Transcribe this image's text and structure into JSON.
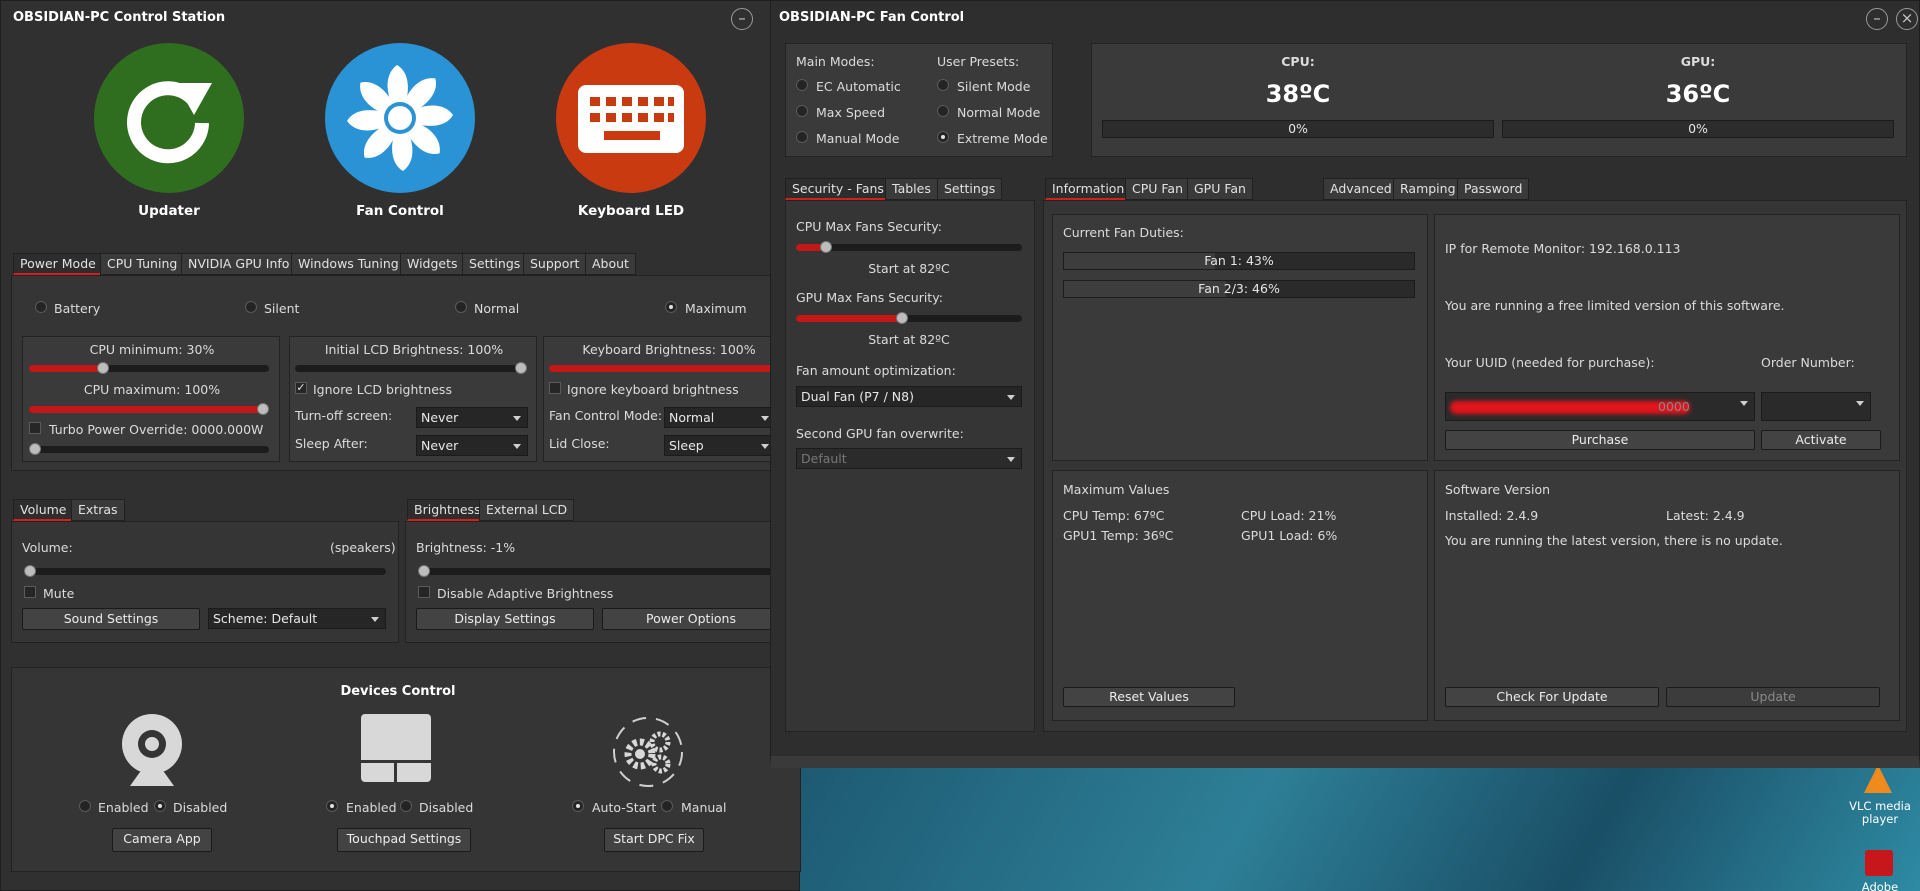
{
  "colors": {
    "accent_red": "#c41818",
    "updater": "#2f6e1f",
    "fan": "#2a93d5",
    "keyboard": "#c93a11",
    "bg": "#303030"
  },
  "control_station": {
    "title": "OBSIDIAN-PC Control Station",
    "big_buttons": [
      {
        "label": "Updater",
        "icon": "refresh-icon"
      },
      {
        "label": "Fan Control",
        "icon": "fan-icon"
      },
      {
        "label": "Keyboard LED",
        "icon": "keyboard-icon"
      }
    ],
    "tabs": [
      "Power Mode",
      "CPU Tuning",
      "NVIDIA GPU Info",
      "Windows Tuning",
      "Widgets",
      "Settings",
      "Support",
      "About"
    ],
    "power_modes": [
      "Battery",
      "Silent",
      "Normal",
      "Maximum"
    ],
    "cpu": {
      "min_label": "CPU minimum: 30%",
      "min": 30,
      "max_label": "CPU maximum: 100%",
      "max": 100,
      "turbo_label": "Turbo Power Override: 0000.000W"
    },
    "lcd": {
      "brightness_label": "Initial LCD Brightness: 100%",
      "brightness": 100,
      "ignore_label": "Ignore LCD brightness",
      "turnoff_label": "Turn-off screen:",
      "turnoff_value": "Never",
      "sleep_label": "Sleep After:",
      "sleep_value": "Never"
    },
    "keyboard": {
      "brightness_label": "Keyboard Brightness: 100%",
      "brightness": 100,
      "ignore_label": "Ignore keyboard brightness",
      "fan_mode_label": "Fan Control Mode:",
      "fan_mode_value": "Normal",
      "lid_label": "Lid Close:",
      "lid_value": "Sleep"
    },
    "volume": {
      "tabs": [
        "Volume",
        "Extras"
      ],
      "label": "Volume:",
      "device": "(speakers)",
      "value": 0,
      "mute_label": "Mute",
      "sound_btn": "Sound Settings",
      "scheme": "Scheme: Default"
    },
    "brightness": {
      "tabs": [
        "Brightness",
        "External LCD"
      ],
      "label": "Brightness: -1%",
      "value": 0,
      "adaptive_label": "Disable Adaptive Brightness",
      "display_btn": "Display Settings",
      "power_btn": "Power Options"
    },
    "devices": {
      "title": "Devices Control",
      "camera": {
        "opt1": "Enabled",
        "opt2": "Disabled",
        "button": "Camera App"
      },
      "touchpad": {
        "opt1": "Enabled",
        "opt2": "Disabled",
        "button": "Touchpad Settings"
      },
      "dpc": {
        "opt1": "Auto-Start",
        "opt2": "Manual",
        "button": "Start DPC Fix"
      }
    }
  },
  "fan_control": {
    "title": "OBSIDIAN-PC Fan Control",
    "main_modes_label": "Main Modes:",
    "main_modes": [
      "EC Automatic",
      "Max Speed",
      "Manual Mode"
    ],
    "presets_label": "User Presets:",
    "presets": [
      "Silent Mode",
      "Normal Mode",
      "Extreme Mode"
    ],
    "cpu": {
      "label": "CPU:",
      "temp": "38ºC",
      "load_text": "0%",
      "load": 0
    },
    "gpu": {
      "label": "GPU:",
      "temp": "36ºC",
      "load_text": "0%",
      "load": 0
    },
    "left_tabs": [
      "Security - Fans",
      "Tables",
      "Settings"
    ],
    "security": {
      "cpu_label": "CPU Max Fans Security:",
      "cpu_start": "Start at 82ºC",
      "cpu_value": 82,
      "gpu_label": "GPU Max Fans Security:",
      "gpu_start": "Start at 82ºC",
      "gpu_value": 82,
      "opt_label": "Fan amount optimization:",
      "opt_value": "Dual Fan (P7 / N8)",
      "gpu_over_label": "Second GPU fan overwrite:",
      "gpu_over_value": "Default"
    },
    "right_tabs": [
      "Information",
      "CPU Fan",
      "GPU Fan"
    ],
    "right_tabs2": [
      "Advanced",
      "Ramping",
      "Password"
    ],
    "duties": {
      "title": "Current Fan Duties:",
      "fans": [
        {
          "label": "Fan 1:   43%",
          "value": 43
        },
        {
          "label": "Fan 2/3:   46%",
          "value": 46
        }
      ]
    },
    "remote": {
      "ip": "IP for Remote Monitor: 192.168.0.113",
      "free_msg": "You are running a free limited version of this software.",
      "uuid_label": "Your UUID (needed for purchase):",
      "order_label": "Order Number:",
      "uuid_tail": "0000",
      "purchase": "Purchase",
      "activate": "Activate"
    },
    "max_values": {
      "title": "Maximum Values",
      "cpu_temp": "CPU Temp: 67ºC",
      "cpu_load": "CPU Load: 21%",
      "gpu_temp": "GPU1 Temp: 36ºC",
      "gpu_load": "GPU1 Load: 6%",
      "reset": "Reset Values"
    },
    "version": {
      "title": "Software Version",
      "installed": "Installed: 2.4.9",
      "latest": "Latest: 2.4.9",
      "msg": "You are running the latest version, there is no update.",
      "check": "Check For Update",
      "update": "Update"
    }
  },
  "desktop": {
    "icons": [
      {
        "label": "VLC media player",
        "icon": "vlc-icon"
      },
      {
        "label": "Adobe",
        "icon": "adobe-icon"
      }
    ]
  }
}
